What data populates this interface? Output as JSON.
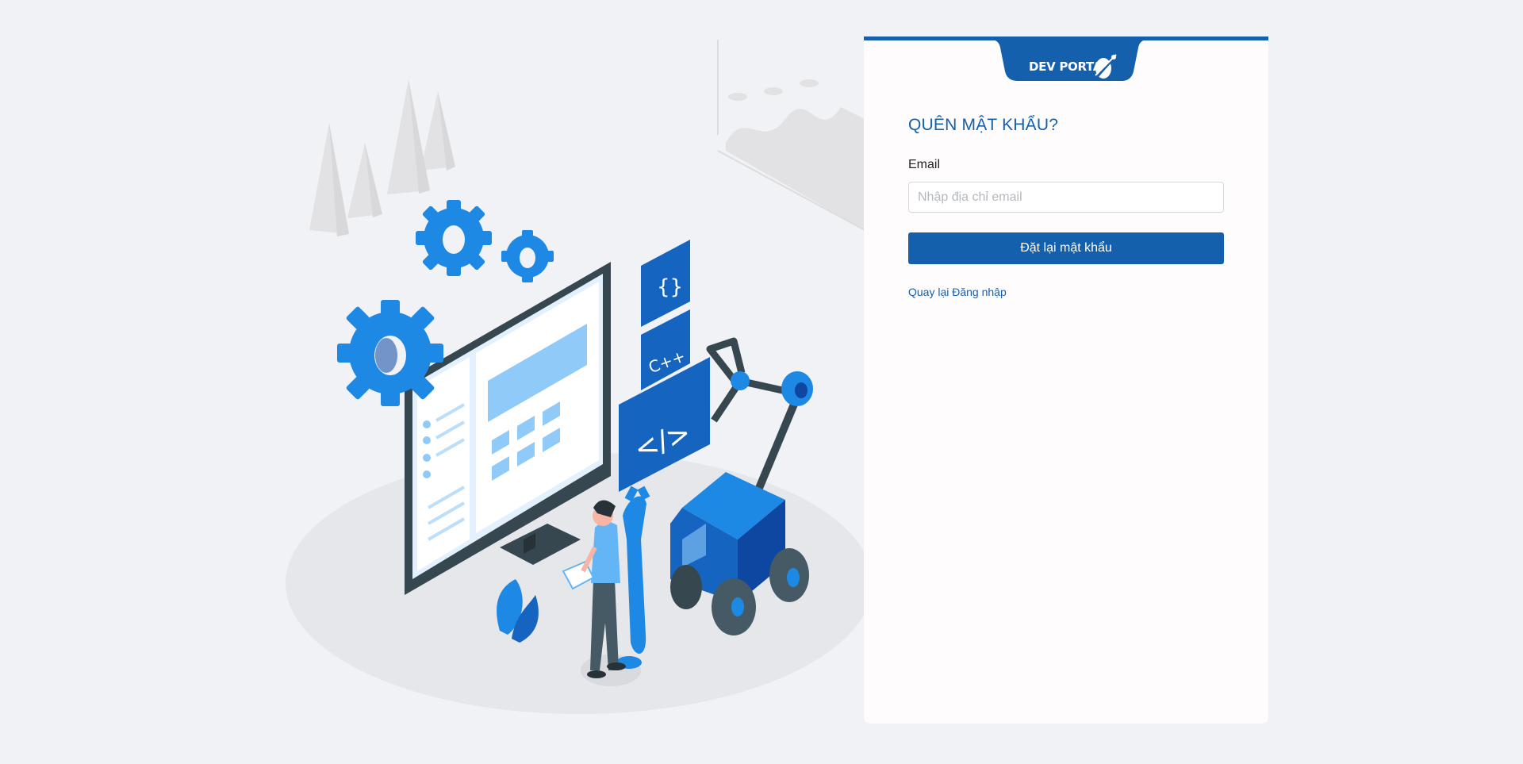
{
  "brand": {
    "name": "DEV PORTAL",
    "color": "#1560ac"
  },
  "form": {
    "title": "QUÊN MẬT KHẨU?",
    "email_label": "Email",
    "email_placeholder": "Nhập địa chỉ email",
    "email_value": "",
    "submit_label": "Đặt lại mật khẩu",
    "back_link_label": "Quay lại Đăng nhập"
  },
  "illustration": {
    "code_tiles": [
      "{}",
      "C++",
      "</>"
    ],
    "accent_color": "#1e88e5"
  }
}
